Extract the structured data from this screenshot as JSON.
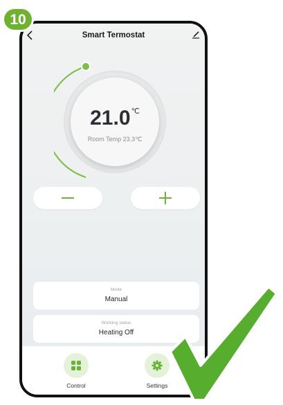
{
  "step_badge": {
    "number": "10"
  },
  "header": {
    "title": "Smart Termostat",
    "back_icon": "chevron-left-icon",
    "edit_icon": "pencil-icon"
  },
  "thermostat": {
    "setpoint_value": "21.0",
    "setpoint_unit": "℃",
    "room_temp_text": "Room Temp 23.3℃"
  },
  "controls": {
    "decrease_icon": "minus-icon",
    "increase_icon": "plus-icon"
  },
  "mode": {
    "label": "Mode",
    "value": "Manual"
  },
  "working_status": {
    "label": "Working status",
    "value": "Heating Off"
  },
  "bottom_nav": {
    "items": [
      {
        "label": "Control",
        "icon": "grid-icon"
      },
      {
        "label": "Settings",
        "icon": "gear-icon"
      }
    ]
  },
  "colors": {
    "accent_green": "#6bb23a",
    "badge_green": "#6fb22f",
    "check_green": "#56ad2e"
  }
}
